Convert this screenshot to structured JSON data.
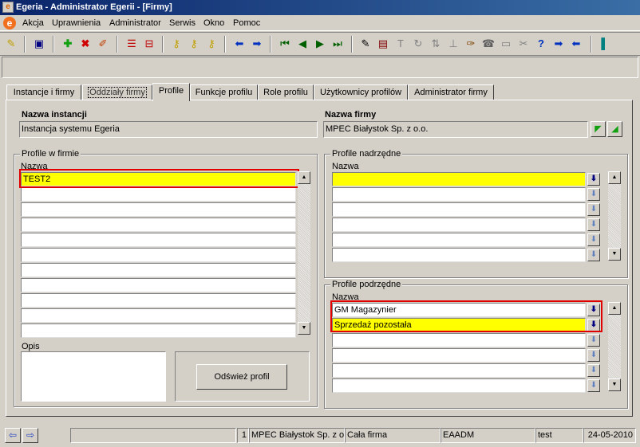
{
  "window": {
    "title": "Egeria - Administrator Egerii - [Firmy]",
    "app_icon": "egeria-logo-icon"
  },
  "menu": {
    "items": [
      "Akcja",
      "Uprawnienia",
      "Administrator",
      "Serwis",
      "Okno",
      "Pomoc"
    ]
  },
  "toolbar": {
    "icons": [
      "pin-icon",
      "save-icon",
      "add-icon",
      "delete-icon",
      "edit-icon",
      "insert-row-icon",
      "split-icon",
      "key-search-icon",
      "key-icon",
      "key-question-icon",
      "back-arrow-icon",
      "forward-arrow-icon",
      "first-record-icon",
      "previous-record-icon",
      "next-record-icon",
      "last-record-icon",
      "report-icon",
      "print-icon",
      "text-icon",
      "refresh-icon",
      "sort-icon",
      "tree-icon",
      "brush-icon",
      "phone-icon",
      "keyboard-icon",
      "tools-icon",
      "help-icon",
      "go-right-icon",
      "go-left-icon",
      "exit-door-icon"
    ]
  },
  "tabs": [
    "Instancje i firmy",
    "Oddziały firmy",
    "Profile",
    "Funkcje profilu",
    "Role profilu",
    "Użytkownicy profilów",
    "Administrator firmy"
  ],
  "header": {
    "instance_label": "Nazwa instancji",
    "instance_value": "Instancja systemu Egeria",
    "company_label": "Nazwa firmy",
    "company_value": "MPEC Białystok Sp. z o.o."
  },
  "profiles": {
    "caption": "Profile w firmie",
    "column": "Nazwa",
    "rows": [
      "TEST2",
      "",
      "",
      "",
      "",
      "",
      "",
      "",
      "",
      "",
      ""
    ]
  },
  "description": {
    "label": "Opis",
    "value": ""
  },
  "refresh_button": "Odśwież profil",
  "parent_profiles": {
    "caption": "Profile nadrzędne",
    "column": "Nazwa",
    "rows": [
      "",
      "",
      "",
      "",
      "",
      ""
    ]
  },
  "child_profiles": {
    "caption": "Profile podrzędne",
    "column": "Nazwa",
    "rows": [
      "GM Magazynier",
      "Sprzedaż pozostała",
      "",
      "",
      "",
      ""
    ]
  },
  "status": {
    "empty": "",
    "number": "1",
    "company": "MPEC Białystok Sp. z o.o.",
    "scope": "Cała firma",
    "db": "EAADM",
    "user": "test",
    "date": "24-05-2010"
  },
  "colors": {
    "highlight": "#ffff00",
    "selection_border": "#e00000",
    "titlebar": "#0a246a"
  }
}
